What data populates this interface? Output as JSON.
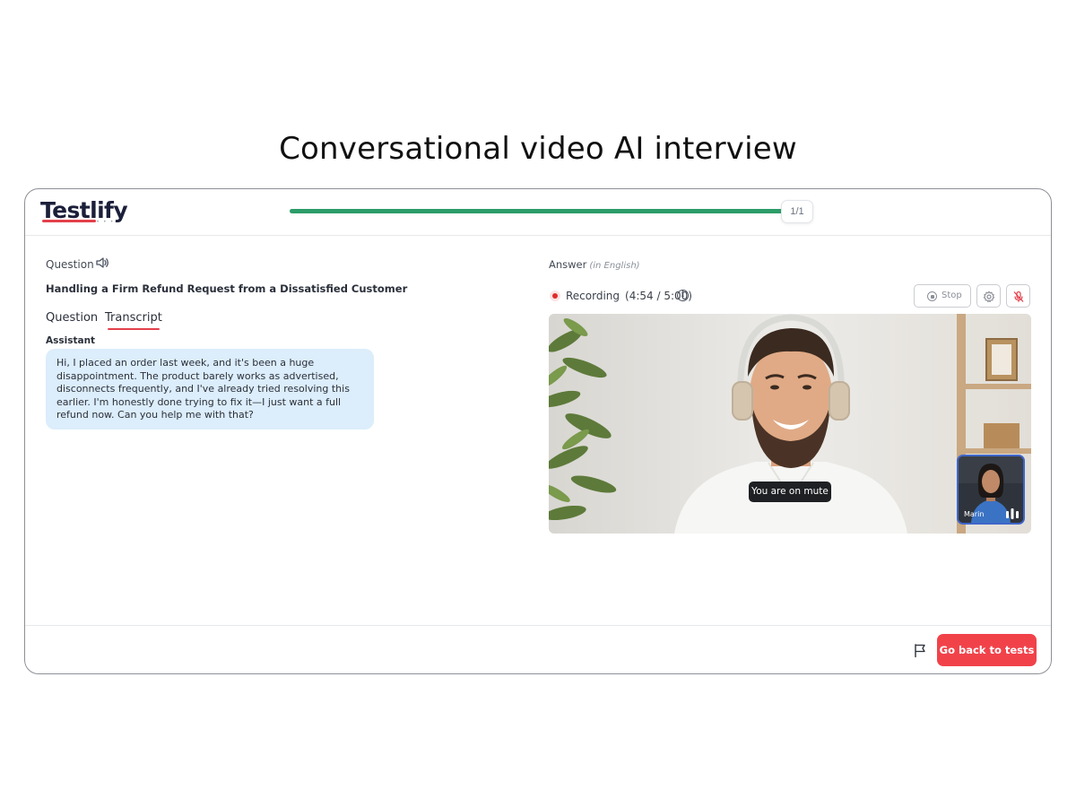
{
  "page": {
    "heading": "Conversational video AI interview"
  },
  "header": {
    "logo": "Testlify",
    "progress": {
      "fraction": 1.0,
      "label": "1/1"
    }
  },
  "question_panel": {
    "label": "Question",
    "title": "Handling a Firm Refund Request from a Dissatisfied Customer",
    "tabs": [
      {
        "label": "Question",
        "active": false
      },
      {
        "label": "Transcript",
        "active": true
      }
    ],
    "transcript": {
      "speaker": "Assistant",
      "message": "Hi, I placed an order last week, and it's been a huge disappointment. The product barely works as advertised, disconnects frequently, and I've already tried resolving this earlier. I'm honestly done trying to fix it—I just want a full refund now. Can you help me with that?"
    }
  },
  "answer_panel": {
    "label": "Answer",
    "language_hint": "(in English)",
    "recording": {
      "status": "Recording",
      "timer": "(4:54 / 5:00)"
    },
    "controls": {
      "stop_label": "Stop"
    },
    "video": {
      "mute_notice": "You are on mute",
      "pip_name": "Marin"
    }
  },
  "footer": {
    "back_button": "Go back to tests"
  },
  "colors": {
    "accent": "#f1424a",
    "progress": "#2c9c69",
    "bubble": "#dcedfb",
    "recording": "#e02a2a",
    "pip_border": "#3f66c9"
  },
  "icons": [
    "speaker-icon",
    "info-icon",
    "stop-icon",
    "settings-gear-icon",
    "mic-muted-icon",
    "audio-level-icon",
    "flag-icon"
  ]
}
